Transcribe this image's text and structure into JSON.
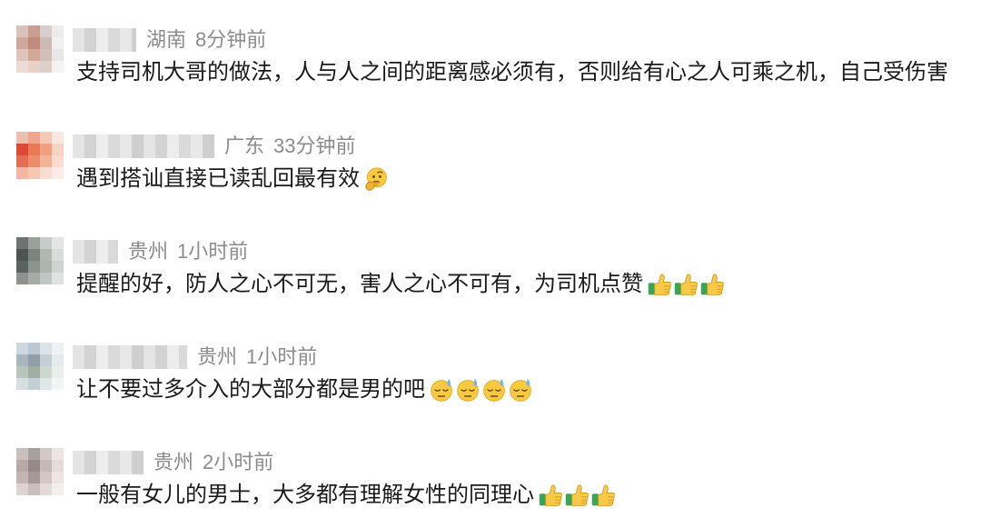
{
  "colors": {
    "background": "#ffffff",
    "meta": "#8c8c8c",
    "text": "#1a1a1a"
  },
  "comments": [
    {
      "location": "湖南",
      "time": "8分钟前",
      "text": "支持司机大哥的做法，人与人之间的距离感必须有，否则给有心之人可乘之机，自己受伤害",
      "emoji": [],
      "avatar_colors": [
        "#d9c3bd",
        "#c99e92",
        "#d7cfcd",
        "#eeeceb",
        "#cfa79c",
        "#c08a7c",
        "#cdbab4",
        "#f1f0f0",
        "#e0c4ba",
        "#d4a896",
        "#d2bfb8",
        "#e9e6e5",
        "#ecdcd5",
        "#e7d1c7",
        "#ddd0cb",
        "#f4f3f3"
      ]
    },
    {
      "location": "广东",
      "time": "33分钟前",
      "text": "遇到搭讪直接已读乱回最有效",
      "emoji": [
        "thinking-face-icon"
      ],
      "avatar_colors": [
        "#e8c0b0",
        "#f0a68c",
        "#f5c9b5",
        "#f8e8e0",
        "#dc4a36",
        "#e97a58",
        "#f0a080",
        "#f6d2c2",
        "#e46c52",
        "#ed8c6a",
        "#f4b397",
        "#fadcce",
        "#f2b7a2",
        "#f6c8b4",
        "#f9ddd0",
        "#fcece5"
      ]
    },
    {
      "location": "贵州",
      "time": "1小时前",
      "text": "提醒的好，防人之心不可无，害人之心不可有，为司机点赞",
      "emoji": [
        "thumbs-up-icon",
        "thumbs-up-icon",
        "thumbs-up-icon"
      ],
      "avatar_colors": [
        "#6f7472",
        "#9aa09c",
        "#c8ccc9",
        "#e4e6e5",
        "#4e5451",
        "#7c8380",
        "#b1b7b3",
        "#d9dcda",
        "#5c625f",
        "#8c928f",
        "#aeb4b0",
        "#d0d4d1",
        "#8d928f",
        "#a6aba8",
        "#c2c6c3",
        "#e0e2e1"
      ]
    },
    {
      "location": "贵州",
      "time": "1小时前",
      "text": "让不要过多介入的大部分都是男的吧",
      "emoji": [
        "sweat-face-icon",
        "sweat-face-icon",
        "sweat-face-icon",
        "sweat-face-icon"
      ],
      "avatar_colors": [
        "#cdd8e0",
        "#b9c8d3",
        "#dbe3e8",
        "#eef2f4",
        "#a9b6bf",
        "#8f9ea7",
        "#c3ced5",
        "#e4eaed",
        "#b8c4bc",
        "#9fb0a2",
        "#cdd7cf",
        "#e8eeea",
        "#d6dee0",
        "#c4d0d3",
        "#e0e7e8",
        "#f2f5f6"
      ]
    },
    {
      "location": "贵州",
      "time": "2小时前",
      "text": "一般有女儿的男士，大多都有理解女性的同理心",
      "emoji": [
        "thumbs-up-icon",
        "thumbs-up-icon",
        "thumbs-up-icon"
      ],
      "avatar_colors": [
        "#c9bfbd",
        "#a8a09f",
        "#d2c8c6",
        "#ebe6e5",
        "#b7a9a8",
        "#968a89",
        "#c6b8b6",
        "#e4dcdb",
        "#c4b4b3",
        "#a59898",
        "#d3c6c5",
        "#ece5e4",
        "#ddd3d2",
        "#c9bebd",
        "#e3dbda",
        "#f3efee"
      ]
    }
  ]
}
